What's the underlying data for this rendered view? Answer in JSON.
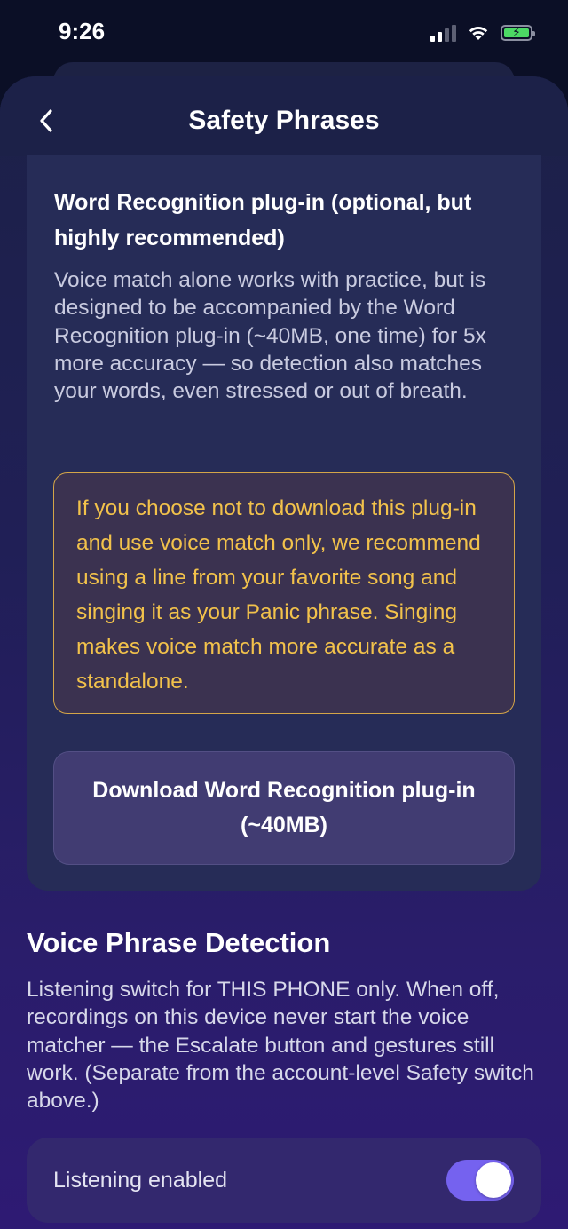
{
  "status_bar": {
    "time": "9:26"
  },
  "nav": {
    "title": "Safety Phrases",
    "back_icon": "chevron-left-icon"
  },
  "plugin": {
    "heading": "Word Recognition plug-in (optional, but highly recommended)",
    "description": "Voice match alone works with practice, but is designed to be accompanied by the Word Recognition plug-in (~40MB, one time) for 5x more accuracy — so detection also matches your words, even stressed or out of breath.",
    "warning": "If you choose not to download this plug-in and use voice match only, we recommend using a line from your favorite song and singing it as your Panic phrase. Singing makes voice match more accurate as a standalone.",
    "download_label": "Download Word Recognition plug-in (~40MB)"
  },
  "voice_detection": {
    "title": "Voice Phrase Detection",
    "description": "Listening switch for THIS PHONE only. When off, recordings on this device never start the voice matcher — the Escalate button and gestures still work. (Separate from the account-level Safety switch above.)",
    "listening_label": "Listening enabled",
    "listening_enabled": true
  },
  "colors": {
    "accent": "#7562ef",
    "warning": "#f2c24b"
  }
}
